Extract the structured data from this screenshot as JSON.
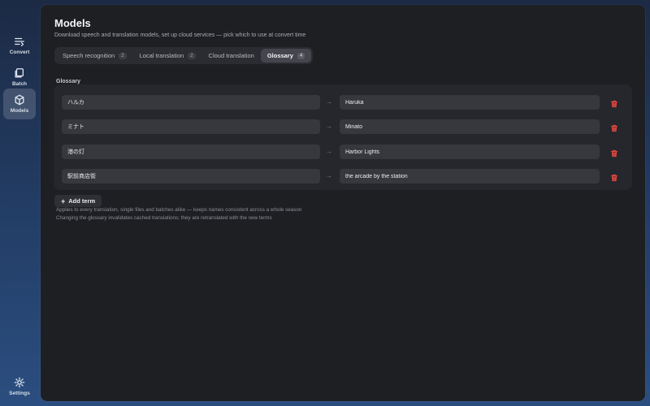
{
  "sidebar": {
    "items": [
      {
        "label": "Convert",
        "icon": "convert-icon"
      },
      {
        "label": "Batch",
        "icon": "batch-icon"
      },
      {
        "label": "Models",
        "icon": "models-cube-icon",
        "active": true
      }
    ],
    "settings": {
      "label": "Settings",
      "icon": "settings-gear-icon"
    }
  },
  "header": {
    "title": "Models",
    "subtitle": "Download speech and translation models, set up cloud services — pick which to use at convert time"
  },
  "tabs": [
    {
      "label": "Speech recognition",
      "count": "2"
    },
    {
      "label": "Local translation",
      "count": "2"
    },
    {
      "label": "Cloud translation",
      "count": ""
    },
    {
      "label": "Glossary",
      "count": "4",
      "active": true
    }
  ],
  "glossary": {
    "section_label": "Glossary",
    "entries": [
      {
        "source": "ハルカ",
        "target": "Haruka"
      },
      {
        "source": "ミナト",
        "target": "Minato"
      },
      {
        "source": "港の灯",
        "target": "Harbor Lights"
      },
      {
        "source": "駅前商店街",
        "target": "the arcade by the station"
      }
    ],
    "add_label": "Add term",
    "help_lines": [
      "Applies to every translation, single files and batches alike — keeps names consistent across a whole season",
      "Changing the glossary invalidates cached translations; they are retranslated with the new terms"
    ]
  },
  "colors": {
    "accent_delete": "#e0463e",
    "panel_bg": "#1e1f23"
  }
}
